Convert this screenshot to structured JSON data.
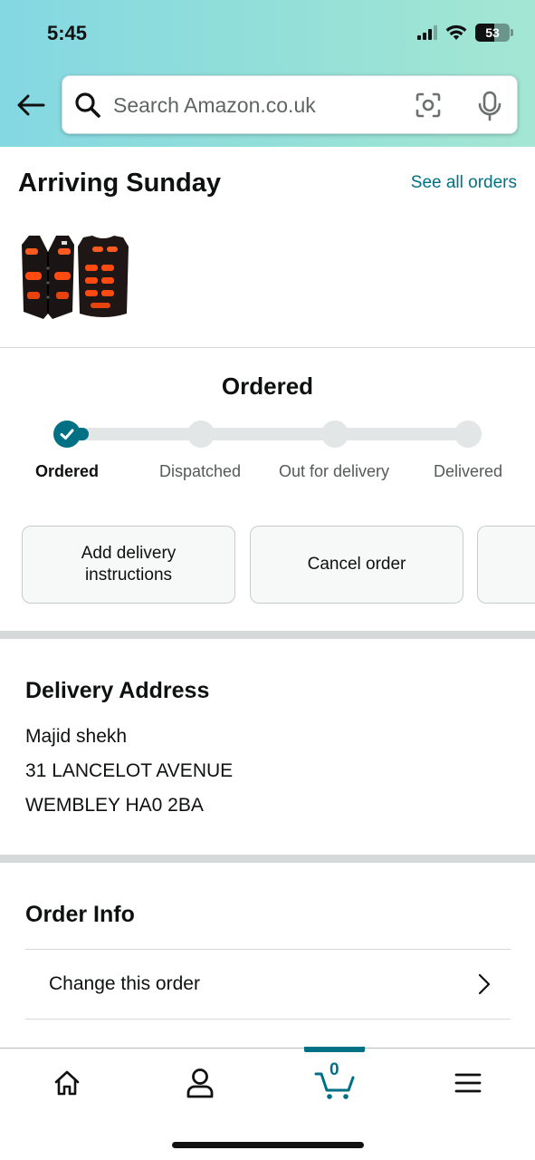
{
  "status_bar": {
    "time": "5:45",
    "battery_level": "53",
    "signal_bars_active": 3,
    "signal_bars_total": 4
  },
  "header": {
    "search_placeholder": "Search Amazon.co.uk"
  },
  "arrival": {
    "title": "Arriving Sunday",
    "see_all_label": "See all orders"
  },
  "progress": {
    "title": "Ordered",
    "current_step": 0,
    "steps": [
      "Ordered",
      "Dispatched",
      "Out for delivery",
      "Delivered"
    ]
  },
  "actions": {
    "add_instructions": "Add delivery instructions",
    "cancel": "Cancel order"
  },
  "delivery_address": {
    "title": "Delivery Address",
    "lines": [
      "Majid shekh",
      "31 LANCELOT AVENUE",
      "WEMBLEY HA0 2BA"
    ]
  },
  "order_info": {
    "title": "Order Info",
    "change_label": "Change this order"
  },
  "bottom_nav": {
    "cart_count": "0"
  },
  "colors": {
    "accent": "#007185",
    "header_start": "#84d8e2",
    "header_end": "#a4e6d3",
    "text": "#0f1111"
  }
}
